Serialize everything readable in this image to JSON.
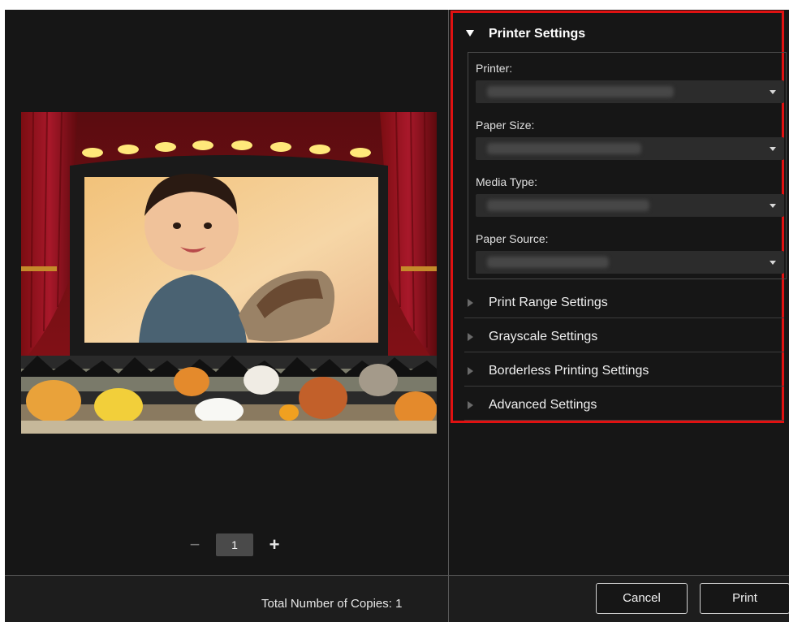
{
  "copies": {
    "value": "1",
    "minus": "−",
    "plus": "+"
  },
  "printer_settings": {
    "title": "Printer Settings",
    "fields": [
      {
        "label": "Printer:"
      },
      {
        "label": "Paper Size:"
      },
      {
        "label": "Media Type:"
      },
      {
        "label": "Paper Source:"
      }
    ]
  },
  "sections": [
    {
      "title": "Print Range Settings"
    },
    {
      "title": "Grayscale Settings"
    },
    {
      "title": "Borderless Printing Settings"
    },
    {
      "title": "Advanced Settings"
    }
  ],
  "footer": {
    "total_copies": "Total Number of Copies:  1",
    "cancel_label": "Cancel",
    "print_label": "Print"
  },
  "colors": {
    "highlight": "#e01111",
    "background": "#161616"
  },
  "icons": {
    "expanded_section": "triangle-down-icon",
    "collapsed_section": "triangle-right-icon",
    "dropdown": "chevron-down-icon"
  }
}
